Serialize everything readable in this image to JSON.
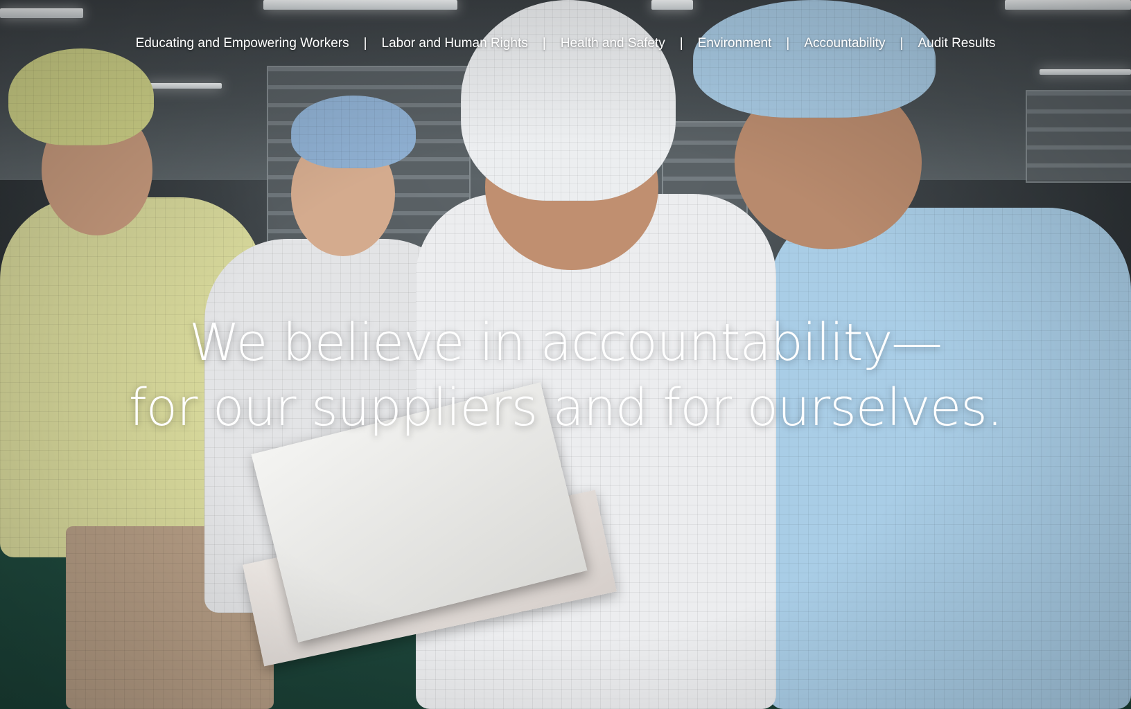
{
  "nav": {
    "items": [
      {
        "label": "Educating and Empowering Workers"
      },
      {
        "label": "Labor and Human Rights"
      },
      {
        "label": "Health and Safety"
      },
      {
        "label": "Environment"
      },
      {
        "label": "Accountability"
      },
      {
        "label": "Audit Results"
      }
    ],
    "separator": "|"
  },
  "hero": {
    "headline_line1": "We believe in accountability—",
    "headline_line2": "for our suppliers and for ourselves."
  },
  "colors": {
    "text": "#ffffff",
    "floor": "#1f4a3e"
  }
}
